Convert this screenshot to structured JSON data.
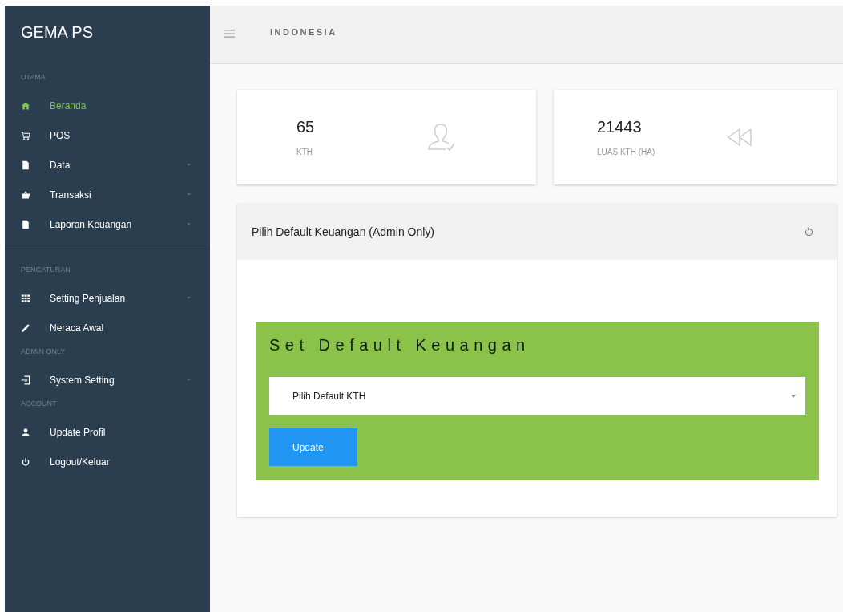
{
  "sidebar": {
    "brand": "GEMA PS",
    "sections": [
      {
        "heading": "UTAMA",
        "divider_after": true,
        "items": [
          {
            "label": "Beranda",
            "kind": "home",
            "selected": true,
            "has_submenu": false
          },
          {
            "label": "POS",
            "kind": "cart",
            "selected": false,
            "has_submenu": false
          },
          {
            "label": "Data",
            "kind": "file",
            "selected": false,
            "has_submenu": true
          },
          {
            "label": "Transaksi",
            "kind": "basket",
            "selected": false,
            "has_submenu": true
          },
          {
            "label": "Laporan Keuangan",
            "kind": "file",
            "selected": false,
            "has_submenu": true
          }
        ]
      },
      {
        "heading": "PENGATURAN",
        "divider_after": false,
        "items": [
          {
            "label": "Setting Penjualan",
            "kind": "grid",
            "selected": false,
            "has_submenu": true
          },
          {
            "label": "Neraca Awal",
            "kind": "pencil",
            "selected": false,
            "has_submenu": false
          }
        ]
      },
      {
        "heading": "ADMIN ONLY",
        "divider_after": false,
        "items": [
          {
            "label": "System Setting",
            "kind": "signin",
            "selected": false,
            "has_submenu": true
          }
        ]
      },
      {
        "heading": "ACCOUNT",
        "divider_after": false,
        "items": [
          {
            "label": "Update Profil",
            "kind": "user",
            "selected": false,
            "has_submenu": false
          },
          {
            "label": "Logout/Keluar",
            "kind": "power",
            "selected": false,
            "has_submenu": false
          }
        ]
      }
    ]
  },
  "header": {
    "title": "INDONESIA"
  },
  "stats": [
    {
      "value": "65",
      "label": "KTH",
      "kind": "user"
    },
    {
      "value": "21443",
      "label": "LUAS KTH (HA)",
      "kind": "rewind"
    }
  ],
  "panel": {
    "title": "Pilih Default Keuangan (Admin Only)",
    "form": {
      "heading": "Set Default Keuangan",
      "select_placeholder": "Pilih Default KTH",
      "button": "Update"
    }
  }
}
